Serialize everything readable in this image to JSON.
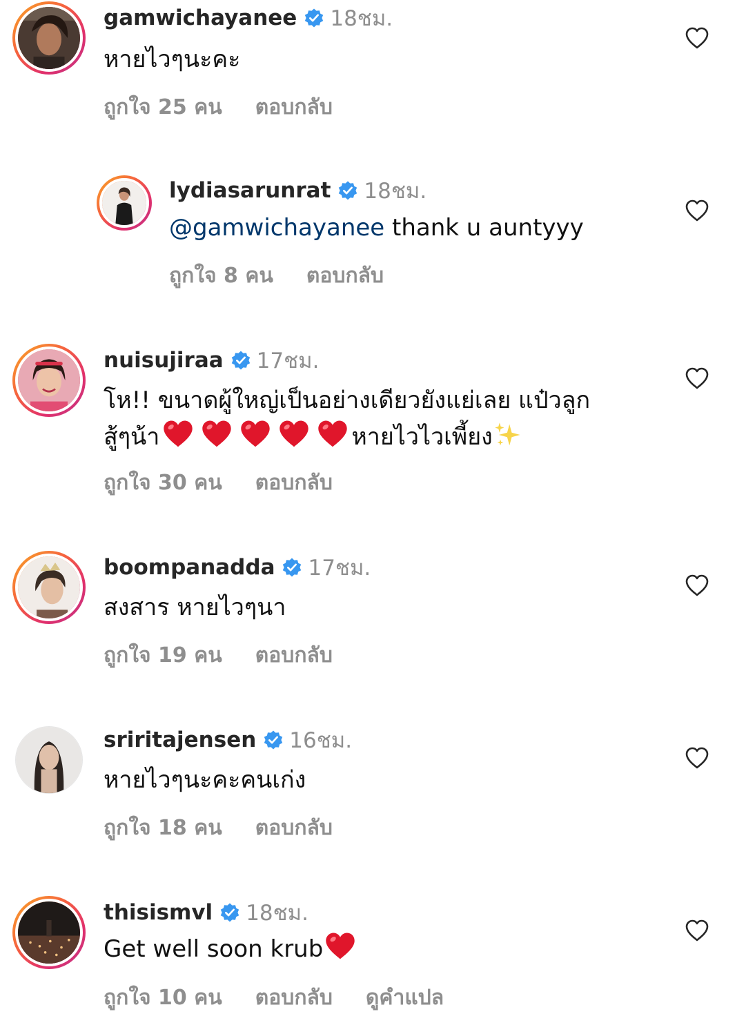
{
  "comments": [
    {
      "username": "gamwichayanee",
      "time": "18ชม.",
      "text": "หายไวๆนะคะ",
      "likes": "ถูกใจ 25 คน",
      "reply": "ตอบกลับ",
      "verified": true
    },
    {
      "username": "lydiasarunrat",
      "time": "18ชม.",
      "mention": "@gamwichayanee",
      "text": " thank u auntyyy",
      "likes": "ถูกใจ 8 คน",
      "reply": "ตอบกลับ",
      "verified": true,
      "is_reply": true
    },
    {
      "username": "nuisujiraa",
      "time": "17ชม.",
      "text_line1": "โห!! ขนาดผู้ใหญ่เป็นอย่างเดียวยังแย่เลย แป๋วลูก",
      "text_line2_start": "สู้ๆน้า",
      "text_line2_end": "หายไวไวเพี้ยง",
      "likes": "ถูกใจ 30 คน",
      "reply": "ตอบกลับ",
      "verified": true
    },
    {
      "username": "boompanadda",
      "time": "17ชม.",
      "text": "สงสาร หายไวๆนา",
      "likes": "ถูกใจ 19 คน",
      "reply": "ตอบกลับ",
      "verified": true
    },
    {
      "username": "sriritajensen",
      "time": "16ชม.",
      "text": "หายไวๆนะคะคนเก่ง",
      "likes": "ถูกใจ 18 คน",
      "reply": "ตอบกลับ",
      "verified": true
    },
    {
      "username": "thisismvl",
      "time": "18ชม.",
      "text": "Get well soon krub",
      "likes": "ถูกใจ 10 คน",
      "reply": "ตอบกลับ",
      "translate": "ดูคำแปล",
      "verified": true
    }
  ],
  "colors": {
    "verified": "#3897f0",
    "secondary_text": "#8e8e8e",
    "mention": "#00376b",
    "heart_emoji": "#e0162b"
  },
  "icons": {
    "verified": "verified-badge-icon",
    "like": "heart-outline-icon",
    "emoji_heart": "red-heart-emoji",
    "emoji_sparkle": "sparkles-emoji"
  }
}
